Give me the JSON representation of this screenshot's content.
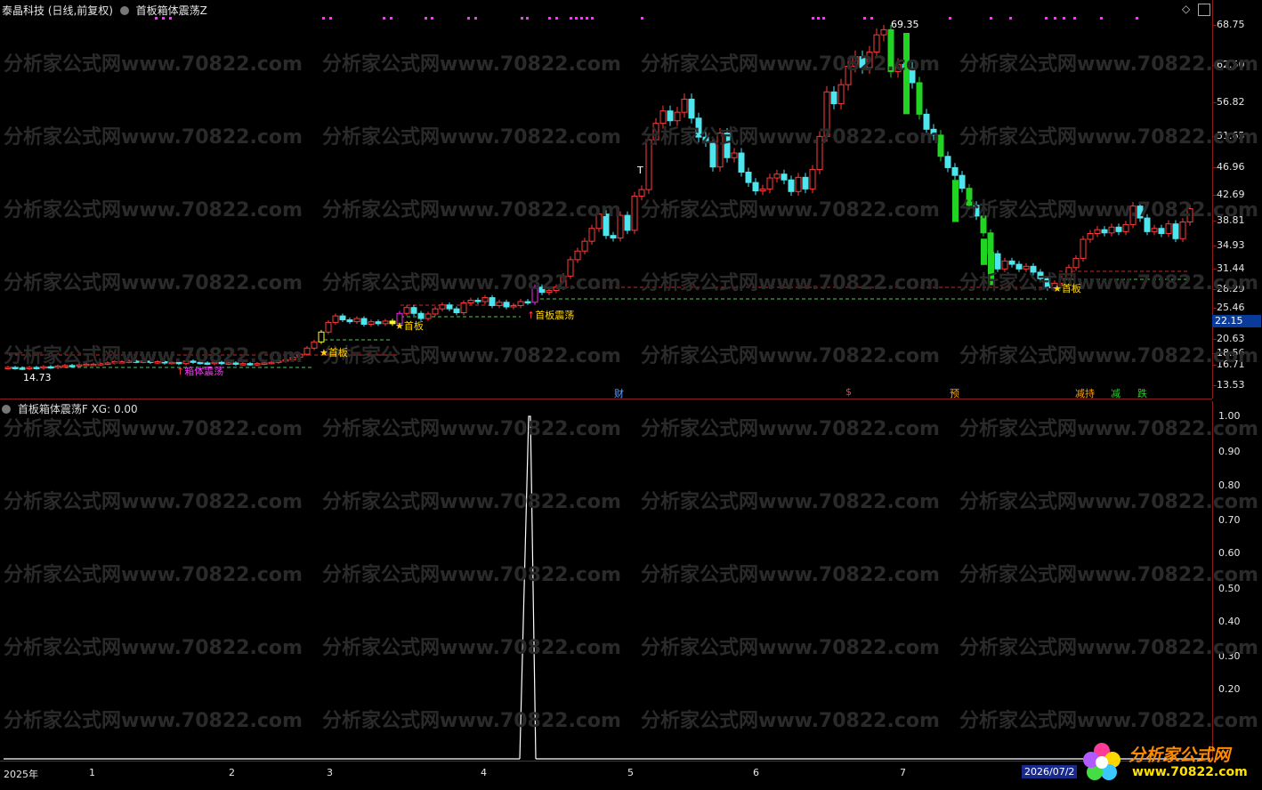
{
  "header": {
    "stock_title": "泰晶科技 (日线,前复权)",
    "indicator_title": "首板箱体震荡Z"
  },
  "sub_header": {
    "indicator_title": "首板箱体震荡F",
    "value_text": "XG: 0.00"
  },
  "main_axis": {
    "ticks": [
      "68.75",
      "62.50",
      "56.82",
      "51.65",
      "46.96",
      "42.69",
      "38.81",
      "34.93",
      "31.44",
      "28.29",
      "25.46",
      "20.63",
      "18.56",
      "16.71",
      "13.53"
    ],
    "current_price": "22.15"
  },
  "sub_axis": {
    "ticks": [
      "1.00",
      "0.90",
      "0.80",
      "0.70",
      "0.60",
      "0.50",
      "0.40",
      "0.30",
      "0.20"
    ]
  },
  "chart_labels": {
    "high_label": "69.35",
    "low_label": "14.73",
    "first_board": "首板",
    "box_oscillation": "箱体震荡",
    "first_board_box": "首板震荡",
    "t_marker": "T"
  },
  "events": [
    "财",
    "$",
    "预",
    "减持",
    "减",
    "跌"
  ],
  "date_axis": {
    "labels": [
      "2025年",
      "1",
      "2",
      "3",
      "4",
      "5",
      "6",
      "7"
    ],
    "current_date": "2026/07/2"
  },
  "watermark": "分析家公式网www.70822.com",
  "logo": {
    "name": "分析家公式网",
    "url": "www.70822.com"
  },
  "colors": {
    "up": "#ff3b3b",
    "down": "#4ee6ee",
    "green_bar": "#22d422",
    "magenta": "#ff22ff",
    "yellow": "#ffff22",
    "grid_red": "#8b1a1a",
    "dash_green": "#4ccc4c",
    "dash_red": "#cc2a2a"
  },
  "chart_data": {
    "type": "line",
    "title": "首板箱体震荡F",
    "series": [
      {
        "name": "XG",
        "values": [
          0,
          0,
          0,
          0,
          0,
          1,
          0,
          0,
          0
        ]
      }
    ],
    "ylim": [
      0,
      1.05
    ]
  }
}
